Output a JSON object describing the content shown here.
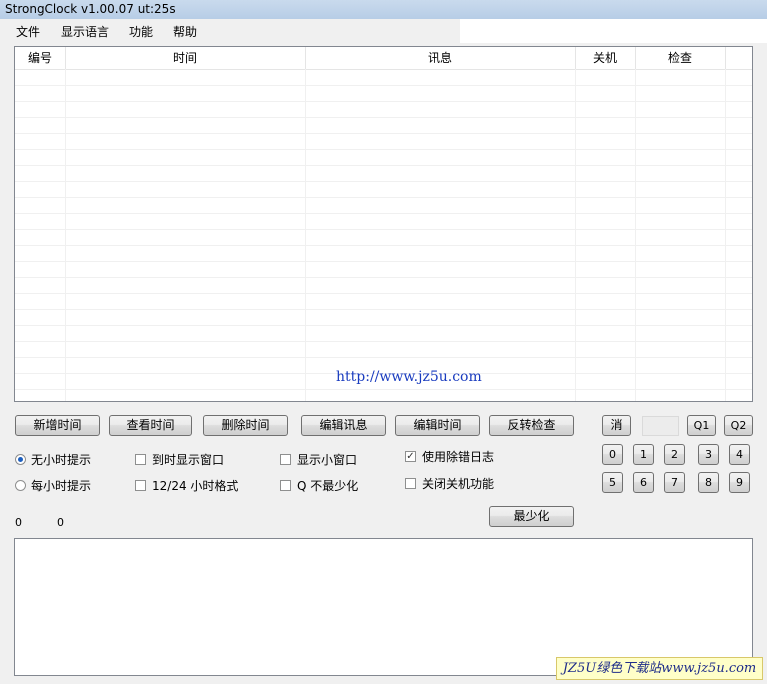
{
  "window": {
    "title": "StrongClock v1.00.07 ut:25s"
  },
  "menu": {
    "items": [
      "文件",
      "显示语言",
      "功能",
      "帮助"
    ]
  },
  "table": {
    "columns": [
      "编号",
      "时间",
      "讯息",
      "关机",
      "检查"
    ]
  },
  "watermark_url": "http://www.jz5u.com",
  "buttons": {
    "add_time": "新增时间",
    "view_time": "查看时间",
    "delete_time": "删除时间",
    "edit_message": "编辑讯息",
    "edit_time": "编辑时间",
    "invert_check": "反转检查",
    "cancel": "消",
    "q1": "Q1",
    "q2": "Q2",
    "minimize": "最少化",
    "digits": [
      "0",
      "1",
      "2",
      "3",
      "4",
      "5",
      "6",
      "7",
      "8",
      "9"
    ]
  },
  "options": {
    "no_hourly": {
      "label": "无小时提示",
      "selected": true
    },
    "hourly": {
      "label": "每小时提示",
      "selected": false
    },
    "show_window_on_time": {
      "label": "到时显示窗口",
      "checked": false
    },
    "format_12_24": {
      "label": "12/24 小时格式",
      "checked": false
    },
    "show_small_window": {
      "label": "显示小窗口",
      "checked": false
    },
    "q_no_minimize": {
      "label": "Q 不最少化",
      "checked": false
    },
    "use_debug_log": {
      "label": "使用除错日志",
      "checked": true
    },
    "disable_shutdown": {
      "label": "关闭关机功能",
      "checked": false
    }
  },
  "status": {
    "left_value": "0",
    "right_value": "0"
  },
  "badge_text": "JZ5U绿色下载站www.jz5u.com"
}
